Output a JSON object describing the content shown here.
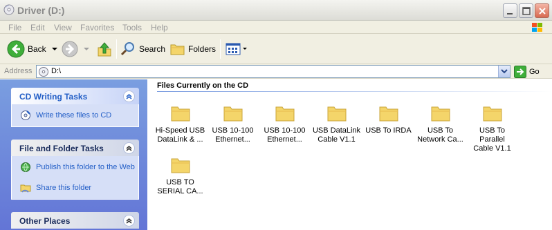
{
  "window": {
    "title": "Driver (D:)",
    "controls": [
      "minimize",
      "maximize",
      "close"
    ]
  },
  "menu": {
    "items": [
      "File",
      "Edit",
      "View",
      "Favorites",
      "Tools",
      "Help"
    ]
  },
  "toolbar": {
    "back_label": "Back",
    "search_label": "Search",
    "folders_label": "Folders"
  },
  "address": {
    "label": "Address",
    "value": "D:\\",
    "go_label": "Go"
  },
  "taskpane": {
    "panels": [
      {
        "title": "CD Writing Tasks",
        "tasks": [
          {
            "label": "Write these files to CD",
            "icon": "cd-write-icon"
          }
        ]
      },
      {
        "title": "File and Folder Tasks",
        "tasks": [
          {
            "label": "Publish this folder to the Web",
            "icon": "publish-web-icon"
          },
          {
            "label": "Share this folder",
            "icon": "share-folder-icon"
          }
        ]
      },
      {
        "title": "Other Places",
        "tasks": []
      }
    ]
  },
  "main": {
    "group_title": "Files Currently on the CD",
    "files": [
      {
        "line1": "Hi-Speed USB",
        "line2": "DataLink & ..."
      },
      {
        "line1": "USB 10-100",
        "line2": "Ethernet..."
      },
      {
        "line1": "USB 10-100",
        "line2": "Ethernet..."
      },
      {
        "line1": "USB DataLink",
        "line2": "Cable V1.1"
      },
      {
        "line1": "USB To IRDA",
        "line2": ""
      },
      {
        "line1": "USB To",
        "line2": "Network Ca..."
      },
      {
        "line1": "USB To Parallel",
        "line2": "Cable V1.1"
      },
      {
        "line1": "USB TO",
        "line2": "SERIAL CA..."
      }
    ]
  },
  "colors": {
    "taskpane_top": "#7a9ee0",
    "taskpane_bottom": "#6375d6",
    "link_blue": "#215dc6",
    "folder_yellow": "#f4d56a"
  }
}
